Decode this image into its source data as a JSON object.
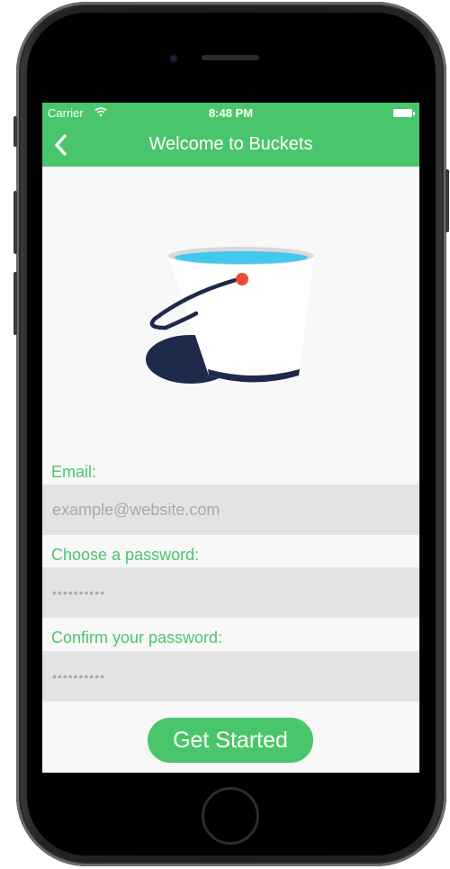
{
  "status_bar": {
    "carrier": "Carrier",
    "time": "8:48 PM",
    "icons": [
      "wifi-icon",
      "battery-icon"
    ]
  },
  "nav": {
    "title": "Welcome to Buckets",
    "back_icon": "chevron-left-icon"
  },
  "form": {
    "email_label": "Email:",
    "email_placeholder": "example@website.com",
    "password_label": "Choose a password:",
    "password_value": "••••••••••",
    "confirm_label": "Confirm your password:",
    "confirm_value": "••••••••••"
  },
  "cta": {
    "label": "Get Started"
  },
  "colors": {
    "accent": "#49c66b",
    "field_bg": "#e3e3e3",
    "background": "#f8f8f8"
  }
}
